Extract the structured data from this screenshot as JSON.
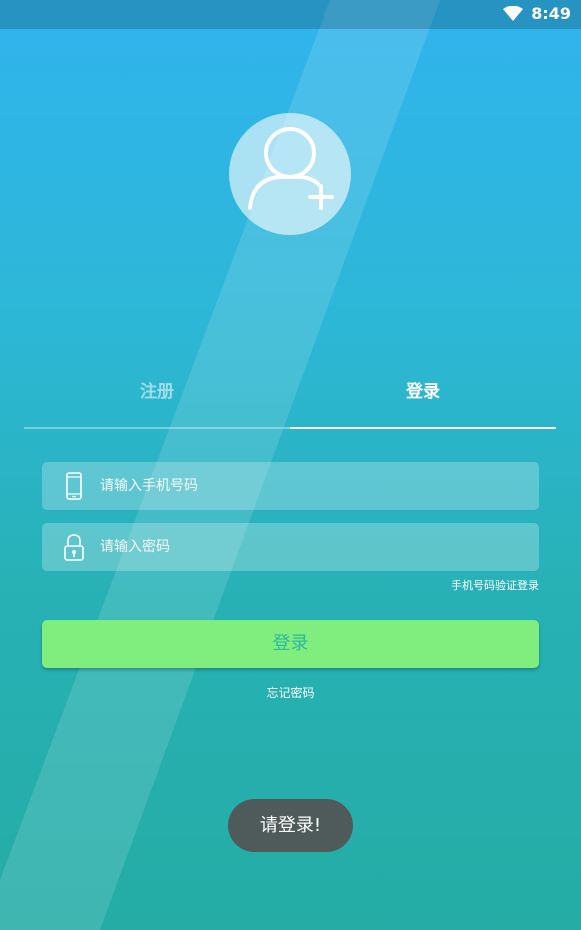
{
  "status_bar": {
    "time": "8:49",
    "wifi_icon": "wifi-icon"
  },
  "avatar": {
    "icon": "add-user-icon"
  },
  "tabs": [
    {
      "label": "注册",
      "active": false
    },
    {
      "label": "登录",
      "active": true
    }
  ],
  "form": {
    "phone": {
      "placeholder": "请输入手机号码",
      "value": "",
      "icon": "phone-icon"
    },
    "password": {
      "placeholder": "请输入密码",
      "value": "",
      "icon": "lock-icon"
    },
    "sms_login_link": "手机号码验证登录",
    "login_button": "登录",
    "forgot_password": "忘记密码"
  },
  "toast": {
    "message": "请登录!"
  },
  "colors": {
    "button_bg": "#7fee7e",
    "button_text": "#2fb89c",
    "toast_bg": "#4f5a5a"
  }
}
